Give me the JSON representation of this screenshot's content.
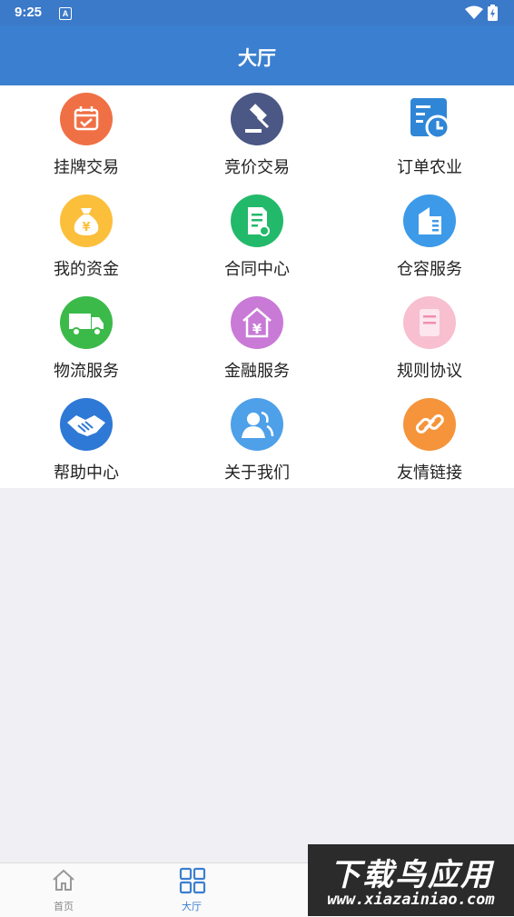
{
  "status_bar": {
    "time": "9:25",
    "notification_letter": "A"
  },
  "header": {
    "title": "大厅"
  },
  "colors": {
    "header": "#3b7fd0",
    "status_bar": "#3b79c9",
    "background": "#efeff4",
    "tab_active": "#3b7fd0"
  },
  "grid": [
    {
      "label": "挂牌交易",
      "icon": "calendar-check-icon",
      "color": "#f07045"
    },
    {
      "label": "竞价交易",
      "icon": "gavel-icon",
      "color": "#4b5785"
    },
    {
      "label": "订单农业",
      "icon": "order-clock-icon",
      "color": "#2f86d6"
    },
    {
      "label": "我的资金",
      "icon": "money-bag-icon",
      "color": "#fbbf3c"
    },
    {
      "label": "合同中心",
      "icon": "contract-icon",
      "color": "#22b96a"
    },
    {
      "label": "仓容服务",
      "icon": "warehouse-icon",
      "color": "#3d9ae8"
    },
    {
      "label": "物流服务",
      "icon": "truck-icon",
      "color": "#3bba4a"
    },
    {
      "label": "金融服务",
      "icon": "finance-house-icon",
      "color": "#c87ad6"
    },
    {
      "label": "规则协议",
      "icon": "document-icon",
      "color": "#f7bfd0"
    },
    {
      "label": "帮助中心",
      "icon": "handshake-icon",
      "color": "#2e79d6"
    },
    {
      "label": "关于我们",
      "icon": "users-icon",
      "color": "#4ea0e8"
    },
    {
      "label": "友情链接",
      "icon": "link-icon",
      "color": "#f5943b"
    }
  ],
  "tabs": [
    {
      "label": "首页",
      "icon": "home-icon",
      "active": false
    },
    {
      "label": "大厅",
      "icon": "grid-icon",
      "active": true
    }
  ],
  "watermark": {
    "title": "下载鸟应用",
    "url": "www.xiazainiao.com"
  }
}
